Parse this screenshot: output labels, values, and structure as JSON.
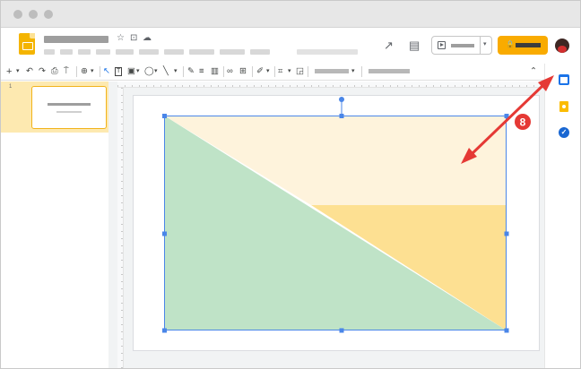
{
  "header": {
    "icons": {
      "star": "☆",
      "folder": "⊡",
      "cloud": "☁"
    },
    "trend_icon": "↗",
    "comment_icon": "▤",
    "present_caret": "▾",
    "share_lock": "🔒"
  },
  "toolbar": {
    "new_slide": "+",
    "dropdown": "▾",
    "undo": "↶",
    "redo": "↷",
    "print": "⎙",
    "paint_format": "⍑",
    "zoom": "⊕",
    "select": "↖",
    "textbox": "T",
    "image": "▣",
    "shape": "◯",
    "line": "╲",
    "pen": "✎",
    "align": "≡",
    "columns": "▥",
    "link": "∞",
    "comment": "⊞",
    "brush": "✐",
    "crop": "⌗",
    "mask": "◲",
    "collapse": "⌃"
  },
  "filmstrip": {
    "slide_number": "1"
  },
  "annotation": {
    "step_number": "8",
    "color": "#e53935"
  },
  "colors": {
    "accent": "#f4b400",
    "triangle_green": "#bfe3c7",
    "triangle_peach_light": "#fef3dc",
    "triangle_peach_dark": "#fde092",
    "selection_blue": "#4a86e8"
  }
}
